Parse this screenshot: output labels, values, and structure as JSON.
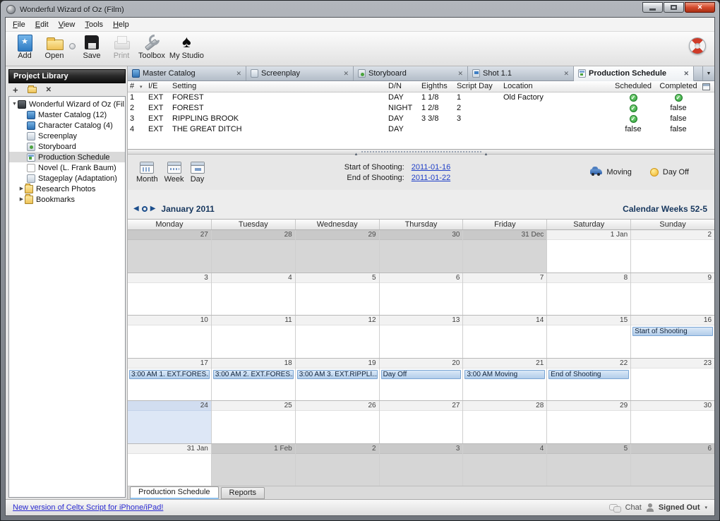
{
  "window": {
    "title": "Wonderful Wizard of Oz (Film)"
  },
  "menu": {
    "items": [
      "File",
      "Edit",
      "View",
      "Tools",
      "Help"
    ]
  },
  "toolbar": {
    "buttons": [
      {
        "id": "add",
        "label": "Add"
      },
      {
        "id": "open",
        "label": "Open"
      },
      {
        "id": "save",
        "label": "Save"
      },
      {
        "id": "print",
        "label": "Print",
        "disabled": true
      },
      {
        "id": "toolbox",
        "label": "Toolbox"
      },
      {
        "id": "mystudio",
        "label": "My Studio"
      }
    ]
  },
  "sidebar": {
    "header": "Project Library",
    "tree": [
      {
        "label": "Wonderful Wizard of Oz (Fil...",
        "icon": "project",
        "expander": "open",
        "level": 0
      },
      {
        "label": "Master Catalog (12)",
        "icon": "catalog",
        "level": 1
      },
      {
        "label": "Character Catalog (4)",
        "icon": "catalog",
        "level": 1
      },
      {
        "label": "Screenplay",
        "icon": "script",
        "level": 1
      },
      {
        "label": "Storyboard",
        "icon": "storyboard",
        "level": 1
      },
      {
        "label": "Production Schedule",
        "icon": "schedule",
        "level": 1,
        "selected": true
      },
      {
        "label": "Novel (L. Frank Baum)",
        "icon": "document",
        "level": 1
      },
      {
        "label": "Stageplay (Adaptation)",
        "icon": "script",
        "level": 1
      },
      {
        "label": "Research Photos",
        "icon": "folder",
        "expander": "closed",
        "level": 1
      },
      {
        "label": "Bookmarks",
        "icon": "folder",
        "expander": "closed",
        "level": 1
      }
    ]
  },
  "tabs": [
    {
      "label": "Master Catalog",
      "icon": "catalog"
    },
    {
      "label": "Screenplay",
      "icon": "script"
    },
    {
      "label": "Storyboard",
      "icon": "storyboard"
    },
    {
      "label": "Shot 1.1",
      "icon": "shot"
    },
    {
      "label": "Production Schedule",
      "icon": "schedule",
      "active": true
    }
  ],
  "shot_table": {
    "columns": [
      "#",
      "I/E",
      "Setting",
      "D/N",
      "Eighths",
      "Script Day",
      "Location",
      "Scheduled",
      "Completed"
    ],
    "rows": [
      {
        "num": "1",
        "ie": "EXT",
        "setting": "FOREST",
        "dn": "DAY",
        "eighths": "1 1/8",
        "script_day": "1",
        "location": "Old Factory",
        "scheduled": true,
        "completed": true
      },
      {
        "num": "2",
        "ie": "EXT",
        "setting": "FOREST",
        "dn": "NIGHT",
        "eighths": "1 2/8",
        "script_day": "2",
        "location": "",
        "scheduled": true,
        "completed": false
      },
      {
        "num": "3",
        "ie": "EXT",
        "setting": "RIPPLING BROOK",
        "dn": "DAY",
        "eighths": "3 3/8",
        "script_day": "3",
        "location": "",
        "scheduled": true,
        "completed": false
      },
      {
        "num": "4",
        "ie": "EXT",
        "setting": "THE GREAT DITCH",
        "dn": "DAY",
        "eighths": "",
        "script_day": "",
        "location": "",
        "scheduled": false,
        "completed": false
      }
    ]
  },
  "schedule_controls": {
    "views": [
      "Month",
      "Week",
      "Day"
    ],
    "start_label": "Start of Shooting:",
    "start_date": "2011-01-16",
    "end_label": "End of Shooting:",
    "end_date": "2011-01-22",
    "legend": [
      {
        "id": "moving",
        "label": "Moving"
      },
      {
        "id": "dayoff",
        "label": "Day Off"
      }
    ]
  },
  "calendar": {
    "month_title": "January 2011",
    "weeks_label": "Calendar Weeks 52-5",
    "day_headers": [
      "Monday",
      "Tuesday",
      "Wednesday",
      "Thursday",
      "Friday",
      "Saturday",
      "Sunday"
    ],
    "weeks": [
      [
        {
          "num": "27",
          "out": true
        },
        {
          "num": "28",
          "out": true
        },
        {
          "num": "29",
          "out": true
        },
        {
          "num": "30",
          "out": true
        },
        {
          "num": "31 Dec",
          "out": true
        },
        {
          "num": "1 Jan"
        },
        {
          "num": "2"
        }
      ],
      [
        {
          "num": "3"
        },
        {
          "num": "4"
        },
        {
          "num": "5"
        },
        {
          "num": "6"
        },
        {
          "num": "7"
        },
        {
          "num": "8"
        },
        {
          "num": "9"
        }
      ],
      [
        {
          "num": "10"
        },
        {
          "num": "11"
        },
        {
          "num": "12"
        },
        {
          "num": "13"
        },
        {
          "num": "14"
        },
        {
          "num": "15"
        },
        {
          "num": "16",
          "events": [
            "Start of Shooting"
          ]
        }
      ],
      [
        {
          "num": "17",
          "events": [
            "3:00 AM 1. EXT.FORES..."
          ]
        },
        {
          "num": "18",
          "events": [
            "3:00 AM 2. EXT.FORES..."
          ]
        },
        {
          "num": "19",
          "events": [
            "3:00 AM 3. EXT.RIPPLI..."
          ]
        },
        {
          "num": "20",
          "events": [
            "Day Off"
          ]
        },
        {
          "num": "21",
          "events": [
            "3:00 AM Moving"
          ]
        },
        {
          "num": "22",
          "events": [
            "End of Shooting"
          ]
        },
        {
          "num": "23"
        }
      ],
      [
        {
          "num": "24",
          "today": true
        },
        {
          "num": "25"
        },
        {
          "num": "26"
        },
        {
          "num": "27"
        },
        {
          "num": "28"
        },
        {
          "num": "29"
        },
        {
          "num": "30"
        }
      ],
      [
        {
          "num": "31 Jan"
        },
        {
          "num": "1 Feb",
          "out": true
        },
        {
          "num": "2",
          "out": true
        },
        {
          "num": "3",
          "out": true
        },
        {
          "num": "4",
          "out": true
        },
        {
          "num": "5",
          "out": true
        },
        {
          "num": "6",
          "out": true
        }
      ]
    ]
  },
  "bottom_tabs": [
    {
      "label": "Production Schedule",
      "active": true
    },
    {
      "label": "Reports"
    }
  ],
  "status_bar": {
    "link": "New version of Celtx Script for iPhone/iPad!",
    "chat_label": "Chat",
    "signed_label": "Signed Out"
  },
  "colors": {
    "check_green": "#2ea339",
    "event_border": "#7aa5d4",
    "event_bg": "#b2cdea",
    "link_blue": "#2040c8",
    "title_navy": "#17375e"
  }
}
